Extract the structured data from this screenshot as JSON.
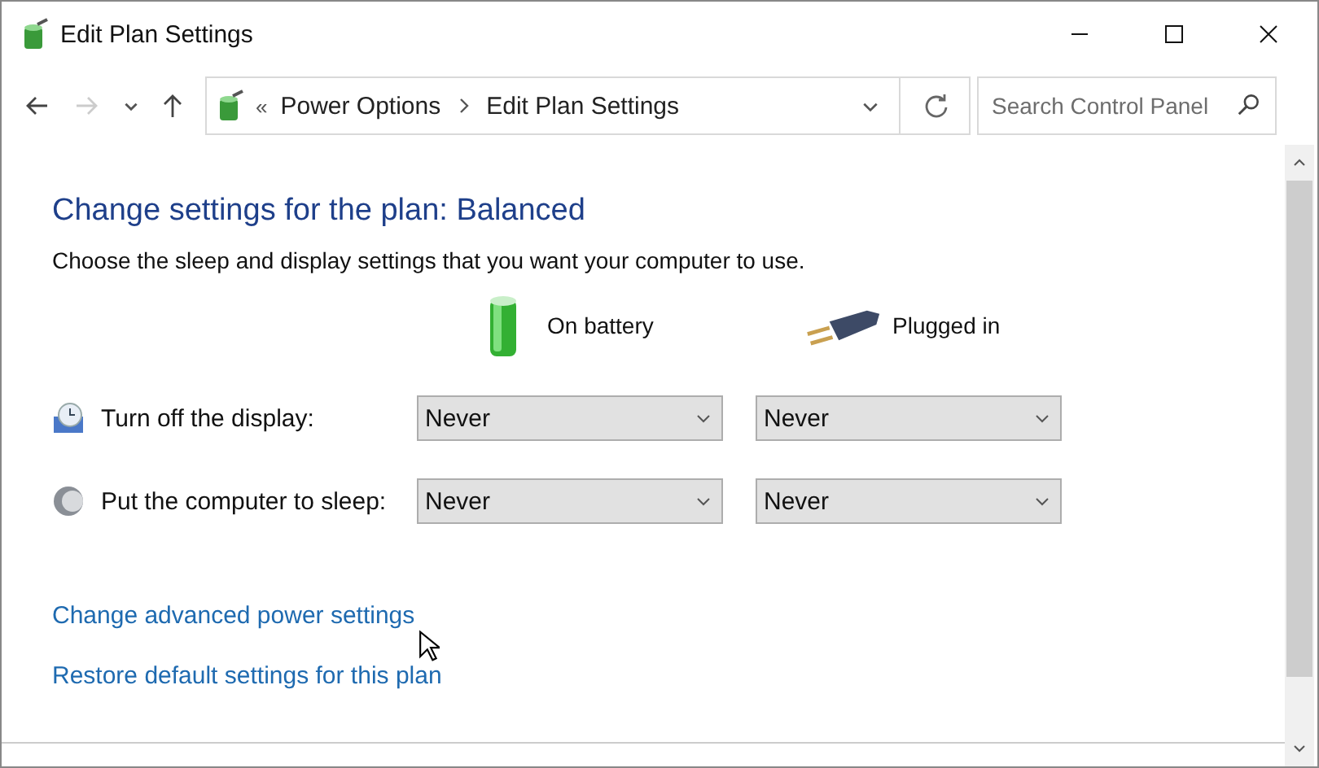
{
  "window": {
    "title": "Edit Plan Settings"
  },
  "nav": {
    "back_disabled": false,
    "forward_disabled": true,
    "prefix": "«",
    "breadcrumb": [
      "Power Options",
      "Edit Plan Settings"
    ],
    "search": {
      "placeholder": "Search Control Panel"
    }
  },
  "heading": "Change settings for the plan: Balanced",
  "description": "Choose the sleep and display settings that you want your computer to use.",
  "columns": [
    {
      "kind": "battery",
      "label": "On battery"
    },
    {
      "kind": "plug",
      "label": "Plugged in"
    }
  ],
  "settings": [
    {
      "kind": "display",
      "label": "Turn off the display:",
      "values": [
        "Never",
        "Never"
      ]
    },
    {
      "kind": "sleep",
      "label": "Put the computer to sleep:",
      "values": [
        "Never",
        "Never"
      ]
    }
  ],
  "links": [
    "Change advanced power settings",
    "Restore default settings for this plan"
  ]
}
